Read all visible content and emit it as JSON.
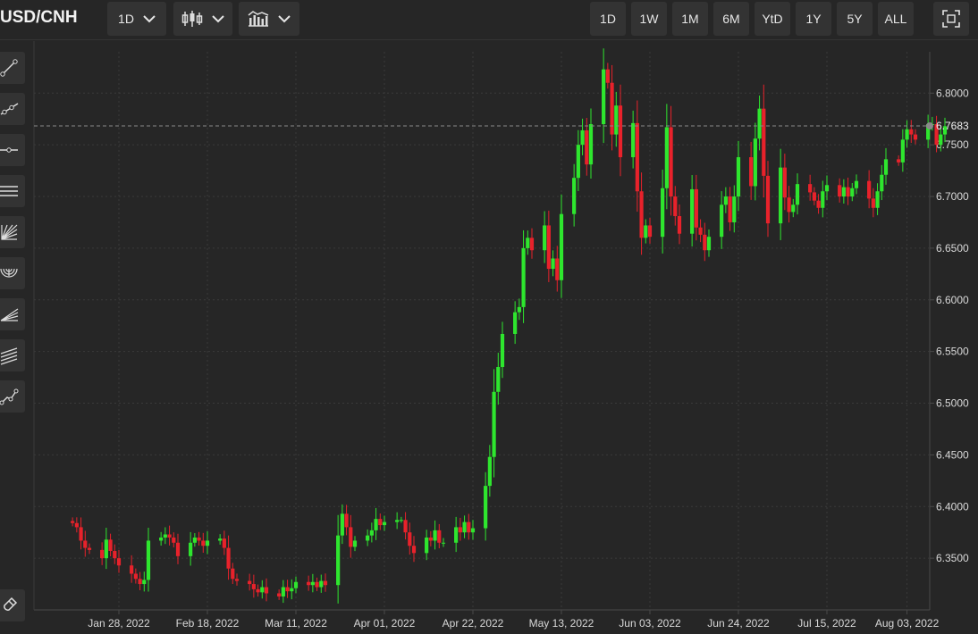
{
  "header": {
    "symbol": "USD/CNH",
    "interval": "1D",
    "ranges": [
      "1D",
      "1W",
      "1M",
      "6M",
      "YtD",
      "1Y",
      "5Y",
      "ALL"
    ]
  },
  "colors": {
    "up": "#2ee62e",
    "down": "#e8222b",
    "background": "#262626",
    "grid": "#3a3a3a",
    "text": "#d9d9d9"
  },
  "sidebar_tools": [
    "trend-line-icon",
    "ray-icon",
    "horizontal-line-icon",
    "parallel-channel-icon",
    "gann-fan-icon",
    "fib-arc-icon",
    "fib-fan-icon",
    "fib-channel-icon",
    "polyline-icon",
    "magnet-icon"
  ],
  "chart_data": {
    "type": "candlestick",
    "series_name": "USD/CNH",
    "last_price": "6.7683",
    "ylim": [
      6.3,
      6.84
    ],
    "y_ticks": [
      "6.3500",
      "6.4000",
      "6.4500",
      "6.5000",
      "6.5500",
      "6.6000",
      "6.6500",
      "6.7000",
      "6.7500",
      "6.8000"
    ],
    "x_ticks": [
      "Jan 28, 2022",
      "Feb 18, 2022",
      "Mar 11, 2022",
      "Apr 01, 2022",
      "Apr 22, 2022",
      "May 13, 2022",
      "Jun 03, 2022",
      "Jun 24, 2022",
      "Jul 15, 2022",
      "Aug 03, 2022"
    ],
    "x_start": "2022-01-17",
    "closes": [
      6.384,
      6.38,
      6.367,
      6.36,
      6.358,
      6.35,
      6.368,
      6.357,
      6.35,
      6.343,
      6.335,
      6.33,
      6.325,
      6.329,
      6.367,
      6.37,
      6.373,
      6.37,
      6.365,
      6.352,
      6.365,
      6.37,
      6.367,
      6.362,
      6.367,
      6.369,
      6.36,
      6.34,
      6.33,
      6.328,
      6.325,
      6.32,
      6.317,
      6.322,
      6.316,
      6.313,
      6.322,
      6.318,
      6.321,
      6.327,
      6.324,
      6.327,
      6.322,
      6.328,
      6.324,
      6.372,
      6.393,
      6.38,
      6.361,
      6.367,
      6.372,
      6.377,
      6.388,
      6.382,
      6.385,
      6.387,
      6.387,
      6.375,
      6.362,
      6.355,
      6.37,
      6.367,
      6.377,
      6.365,
      6.365,
      6.38,
      6.375,
      6.385,
      6.375,
      6.379,
      6.42,
      6.448,
      6.511,
      6.535,
      6.567,
      6.588,
      6.593,
      6.65,
      6.66,
      6.648,
      6.672,
      6.63,
      6.64,
      6.619,
      6.683,
      6.718,
      6.75,
      6.764,
      6.731,
      6.77,
      6.823,
      6.81,
      6.76,
      6.788,
      6.738,
      6.771,
      6.705,
      6.66,
      6.672,
      6.661,
      6.708,
      6.767,
      6.7,
      6.681,
      6.664,
      6.707,
      6.67,
      6.663,
      6.648,
      6.661,
      6.692,
      6.7,
      6.675,
      6.7,
      6.738,
      6.71,
      6.756,
      6.785,
      6.72,
      6.674,
      6.728,
      6.699,
      6.685,
      6.692,
      6.712,
      6.704,
      6.696,
      6.689,
      6.705,
      6.711,
      6.7,
      6.709,
      6.7,
      6.708,
      6.715,
      6.698,
      6.689,
      6.705,
      6.721,
      6.736,
      6.733,
      6.755,
      6.765,
      6.76,
      6.755,
      6.77,
      6.77,
      6.75,
      6.76,
      6.768
    ]
  }
}
